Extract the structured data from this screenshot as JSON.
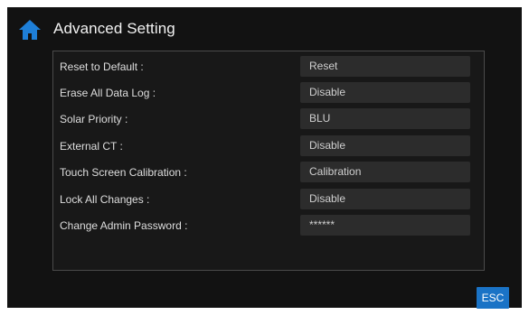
{
  "header": {
    "title": "Advanced Setting",
    "home_icon": "home-icon",
    "home_icon_color": "#1e7fd8"
  },
  "settings": {
    "items": [
      {
        "label": "Reset to Default :",
        "value": "Reset"
      },
      {
        "label": "Erase All Data Log :",
        "value": "Disable"
      },
      {
        "label": "Solar Priority :",
        "value": "BLU"
      },
      {
        "label": "External CT :",
        "value": "Disable"
      },
      {
        "label": "Touch Screen Calibration :",
        "value": "Calibration"
      },
      {
        "label": "Lock All Changes :",
        "value": "Disable"
      },
      {
        "label": "Change Admin Password :",
        "value": "******"
      }
    ]
  },
  "footer": {
    "esc_label": "ESC",
    "esc_color": "#1a73c6"
  }
}
